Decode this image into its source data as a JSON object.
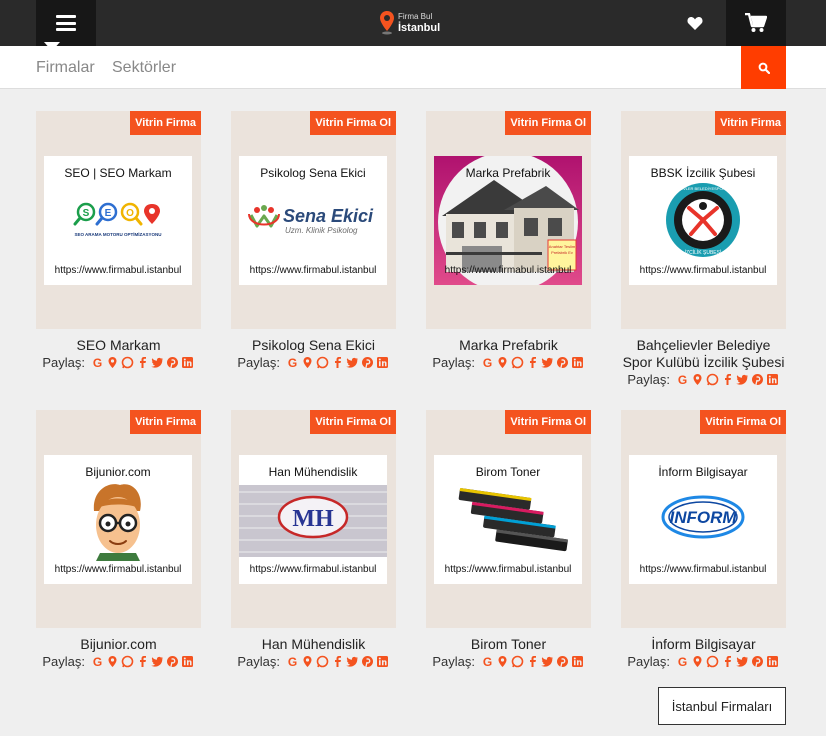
{
  "header": {
    "logo_line1": "Firma Bul",
    "logo_line2": "İstanbul",
    "menu_icon": "hamburger-icon",
    "favorites_icon": "heart-icon",
    "cart_icon": "cart-icon"
  },
  "nav": {
    "firmalar": "Firmalar",
    "sektorler": "Sektörler",
    "search_icon": "search-icon"
  },
  "colors": {
    "accent": "#f4531f",
    "topbar": "#2a2a2a",
    "tile_bg": "#ebe3dc"
  },
  "share_label": "Paylaş:",
  "share_icons": [
    "google-icon",
    "map-pin-icon",
    "whatsapp-icon",
    "facebook-icon",
    "twitter-icon",
    "pinterest-icon",
    "linkedin-icon"
  ],
  "cards": [
    {
      "badge": "Vitrin Firma",
      "logo_title": "SEO | SEO Markam",
      "logo_url": "https://www.firmabul.istanbul",
      "name": "SEO Markam"
    },
    {
      "badge": "Vitrin Firma Ol",
      "logo_title": "Psikolog Sena Ekici",
      "logo_url": "https://www.firmabul.istanbul",
      "name": "Psikolog Sena Ekici"
    },
    {
      "badge": "Vitrin Firma Ol",
      "logo_title": "Marka Prefabrik",
      "logo_url": "https://www.firmabul.istanbul",
      "name": "Marka Prefabrik"
    },
    {
      "badge": "Vitrin Firma",
      "logo_title": "BBSK İzcilik Şubesi",
      "logo_url": "https://www.firmabul.istanbul",
      "name": "Bahçelievler Belediye Spor Kulübü İzcilik Şubesi"
    },
    {
      "badge": "Vitrin Firma",
      "logo_title": "Bijunior.com",
      "logo_url": "https://www.firmabul.istanbul",
      "name": "Bijunior.com"
    },
    {
      "badge": "Vitrin Firma Ol",
      "logo_title": "Han Mühendislik",
      "logo_url": "https://www.firmabul.istanbul",
      "name": "Han Mühendislik"
    },
    {
      "badge": "Vitrin Firma Ol",
      "logo_title": "Birom Toner",
      "logo_url": "https://www.firmabul.istanbul",
      "name": "Birom Toner"
    },
    {
      "badge": "Vitrin Firma Ol",
      "logo_title": "İnform Bilgisayar",
      "logo_url": "https://www.firmabul.istanbul",
      "name": "İnform Bilgisayar"
    }
  ],
  "logo_art_text": {
    "seo_tagline": "SEO ARAMA MOTORU OPTİMİZASYONU",
    "sena_big": "Sena Ekici",
    "sena_small": "Uzm. Klinik Psikolog",
    "prefabrik_note1": "Anahtar Teslim",
    "prefabrik_note2": "Prefabrik Ev",
    "bbsk_ring": "BAHÇELİEVLER BELEDİYESPOR KULÜBÜ",
    "bbsk_bottom": "İZCİLİK ŞUBESİ",
    "han_mark": "MH",
    "inform_mark": "INFORM"
  },
  "footer": {
    "istanbul_firmalari": "İstanbul Firmaları"
  }
}
